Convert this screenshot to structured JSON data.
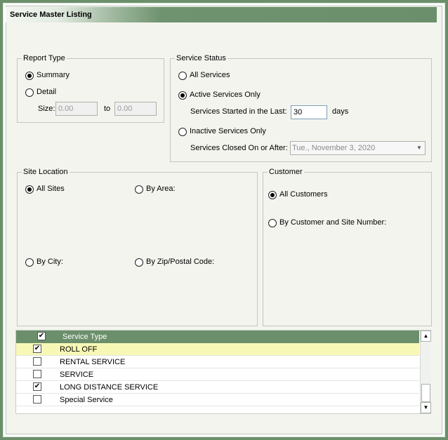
{
  "title": "Service Master Listing",
  "report_type": {
    "legend": "Report Type",
    "summary_label": "Summary",
    "detail_label": "Detail",
    "size_label": "Size:",
    "size_from": "0.00",
    "to_label": "to",
    "size_to": "0.00",
    "selected": "summary"
  },
  "service_status": {
    "legend": "Service Status",
    "all_label": "All Services",
    "active_label": "Active Services Only",
    "started_label": "Services Started in the Last:",
    "started_value": "30",
    "days_label": "days",
    "inactive_label": "Inactive Services Only",
    "closed_label": "Services Closed On or After:",
    "closed_value": "Tue., November 3, 2020",
    "selected": "active"
  },
  "site_location": {
    "legend": "Site Location",
    "all_sites_label": "All Sites",
    "by_area_label": "By Area:",
    "by_city_label": "By City:",
    "by_zip_label": "By Zip/Postal Code:",
    "selected": "all_sites"
  },
  "customer": {
    "legend": "Customer",
    "all_label": "All Customers",
    "by_number_label": "By Customer and Site Number:",
    "selected": "all"
  },
  "service_type_grid": {
    "header_checked": true,
    "header_label": "Service Type",
    "rows": [
      {
        "label": "ROLL OFF",
        "checked": true,
        "selected": true
      },
      {
        "label": "RENTAL SERVICE",
        "checked": false,
        "selected": false
      },
      {
        "label": "SERVICE",
        "checked": false,
        "selected": false
      },
      {
        "label": "LONG DISTANCE SERVICE",
        "checked": true,
        "selected": false
      },
      {
        "label": "Special Service",
        "checked": false,
        "selected": false
      }
    ]
  },
  "colors": {
    "accent": "#6b8f6b",
    "selected_row": "#f8f8b6"
  }
}
